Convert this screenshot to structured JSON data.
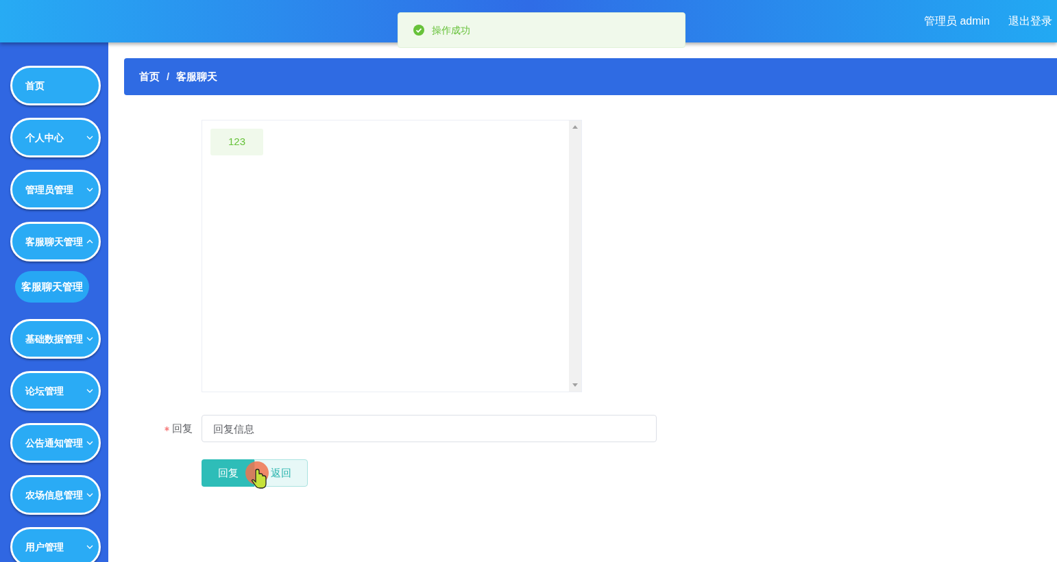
{
  "header": {
    "user": "管理员 admin",
    "logout": "退出登录"
  },
  "toast": {
    "kind": "success",
    "message": "操作成功"
  },
  "sidebar": {
    "items": [
      {
        "label": "首页",
        "kind": "link"
      },
      {
        "label": "个人中心",
        "kind": "submenu",
        "expanded": false
      },
      {
        "label": "管理员管理",
        "kind": "submenu",
        "expanded": false
      },
      {
        "label": "客服聊天管理",
        "kind": "submenu",
        "expanded": true,
        "children": [
          {
            "label": "客服聊天管理"
          }
        ]
      },
      {
        "label": "基础数据管理",
        "kind": "submenu",
        "expanded": false
      },
      {
        "label": "论坛管理",
        "kind": "submenu",
        "expanded": false
      },
      {
        "label": "公告通知管理",
        "kind": "submenu",
        "expanded": false
      },
      {
        "label": "农场信息管理",
        "kind": "submenu",
        "expanded": false
      },
      {
        "label": "用户管理",
        "kind": "submenu",
        "expanded": false
      }
    ]
  },
  "breadcrumb": {
    "items": [
      "首页",
      "客服聊天"
    ],
    "separator": "/"
  },
  "chat": {
    "messages": [
      {
        "text": "123"
      }
    ]
  },
  "form": {
    "reply": {
      "label": "回复",
      "required": true,
      "placeholder": "回复信息"
    },
    "buttons": [
      {
        "label": "回复",
        "kind": "primary"
      },
      {
        "label": "返回",
        "kind": "plain"
      }
    ]
  }
}
